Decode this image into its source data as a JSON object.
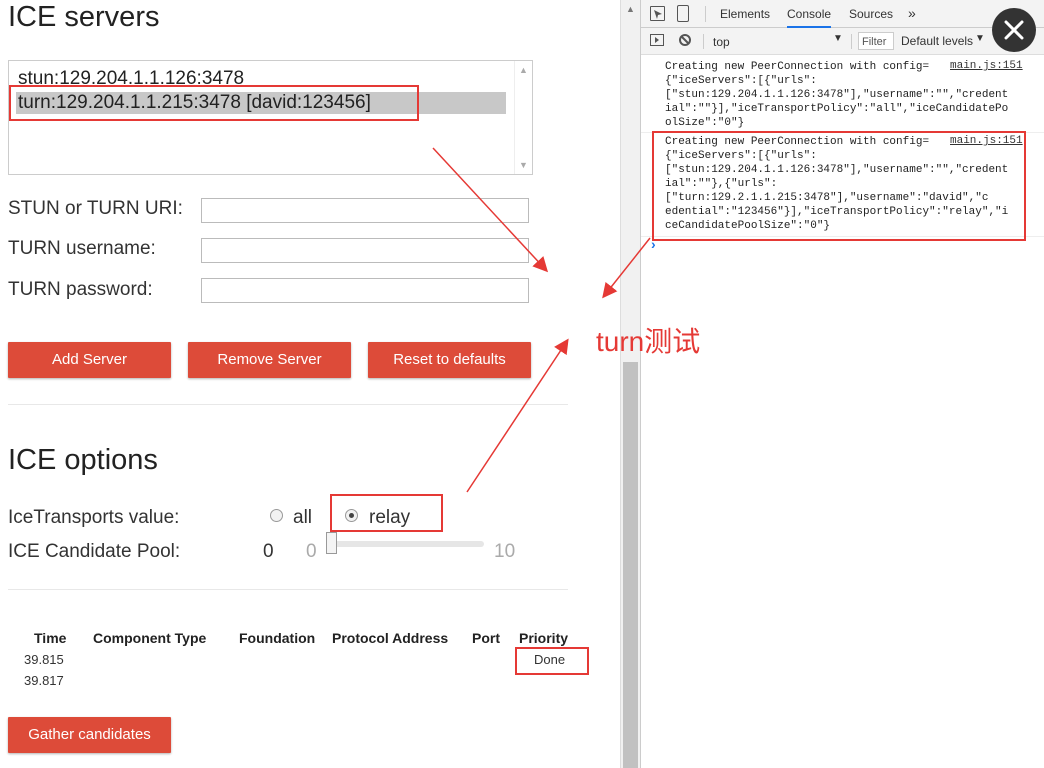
{
  "ice_servers": {
    "title": "ICE servers",
    "list": [
      "stun:129.204.1.1.126:3478",
      "turn:129.204.1.1.215:3478 [david:123456]"
    ],
    "fields": [
      {
        "label": "STUN or TURN URI:",
        "value": ""
      },
      {
        "label": "TURN username:",
        "value": ""
      },
      {
        "label": "TURN password:",
        "value": ""
      }
    ],
    "buttons": {
      "add": "Add Server",
      "remove": "Remove Server",
      "reset": "Reset to defaults"
    }
  },
  "ice_options": {
    "title": "ICE options",
    "transports_label": "IceTransports value:",
    "transport_all": "all",
    "transport_relay": "relay",
    "pool_label": "ICE Candidate Pool:",
    "pool_value": "0",
    "slider_min": "0",
    "slider_max": "10",
    "slider_level": 0
  },
  "candidates": {
    "headers": [
      "Time",
      "Component Type",
      "Foundation",
      "Protocol Address",
      "Port",
      "Priority"
    ],
    "rows": [
      {
        "time": "39.815",
        "priority": "Done"
      },
      {
        "time": "39.817",
        "priority": ""
      }
    ],
    "gather_button": "Gather candidates"
  },
  "devtools": {
    "tabs": [
      "Elements",
      "Console",
      "Sources"
    ],
    "active_tab": "Console",
    "context": "top",
    "filter_placeholder": "Filter",
    "levels": "Default levels",
    "logs": [
      {
        "message": "Creating new PeerConnection with config=",
        "source": "main.js:151",
        "lines": [
          "{\"iceServers\":[{\"urls\":",
          "[\"stun:129.204.1.1.126:3478\"],\"username\":\"\",\"credent",
          "ial\":\"\"}],\"iceTransportPolicy\":\"all\",\"iceCandidatePo",
          "olSize\":\"0\"}"
        ]
      },
      {
        "message": "Creating new PeerConnection with config=",
        "source": "main.js:151",
        "lines": [
          "{\"iceServers\":[{\"urls\":",
          "[\"stun:129.204.1.1.126:3478\"],\"username\":\"\",\"credent",
          "ial\":\"\"},{\"urls\":",
          "[\"turn:129.2.1.1.215:3478\"],\"username\":\"david\",\"c",
          "edential\":\"123456\"}],\"iceTransportPolicy\":\"relay\",\"i",
          "ceCandidatePoolSize\":\"0\"}"
        ]
      }
    ],
    "prompt": "›"
  },
  "annotation": "turn测试",
  "colors": {
    "accent": "#dd4b39",
    "annotation": "#e53935"
  }
}
